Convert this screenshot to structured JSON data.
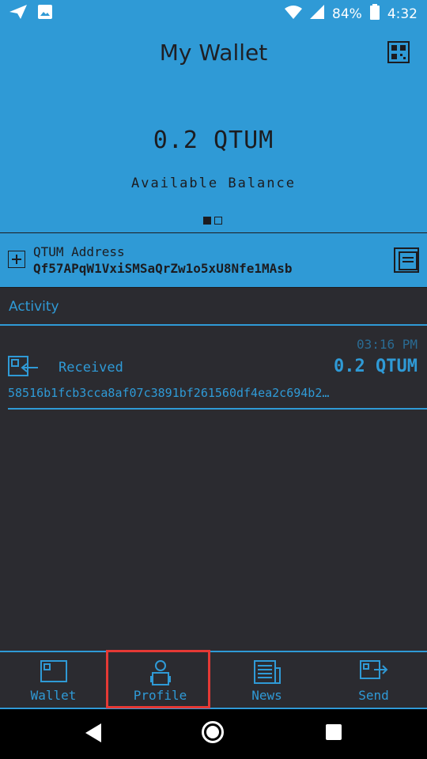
{
  "status_bar": {
    "battery": "84%",
    "time": "4:32"
  },
  "header": {
    "title": "My Wallet",
    "balance": "0.2 QTUM",
    "balance_label": "Available Balance"
  },
  "address": {
    "label": "QTUM Address",
    "value": "Qf57APqW1VxiSMSaQrZw1o5xU8Nfe1MAsb"
  },
  "activity": {
    "title": "Activity",
    "transactions": [
      {
        "time": "03:16 PM",
        "type": "Received",
        "amount": "0.2 QTUM",
        "hash": "58516b1fcb3cca8af07c3891bf261560df4ea2c694b2…"
      }
    ]
  },
  "tabs": [
    {
      "label": "Wallet",
      "icon": "wallet-icon"
    },
    {
      "label": "Profile",
      "icon": "profile-icon"
    },
    {
      "label": "News",
      "icon": "news-icon"
    },
    {
      "label": "Send",
      "icon": "send-icon"
    }
  ],
  "colors": {
    "accent": "#2f9ad6",
    "background": "#2b2b30",
    "highlight": "#e53935"
  }
}
